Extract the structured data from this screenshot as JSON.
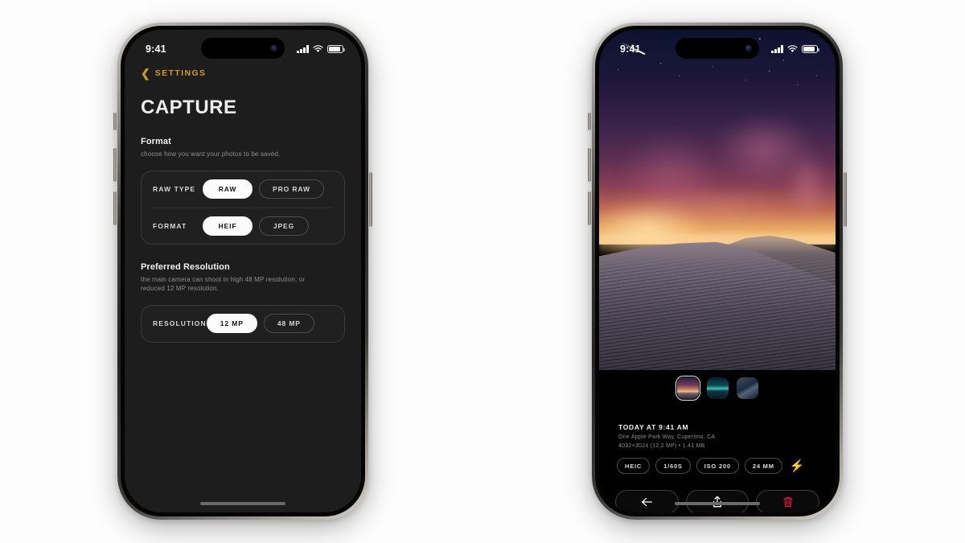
{
  "left_phone": {
    "status_bar": {
      "time": "9:41",
      "cellular_icon": "signal-bars-icon",
      "wifi_icon": "wifi-icon",
      "battery_icon": "battery-icon"
    },
    "nav": {
      "back_icon": "chevron-left-icon",
      "back_label": "SETTINGS",
      "accent_color": "#cf9a1e"
    },
    "page_title": "CAPTURE",
    "sections": [
      {
        "title": "Format",
        "description": "choose how you want your photos to be saved.",
        "rows": [
          {
            "label": "RAW TYPE",
            "options": [
              {
                "label": "RAW",
                "selected": true
              },
              {
                "label": "PRO RAW",
                "selected": false
              }
            ]
          },
          {
            "label": "FORMAT",
            "options": [
              {
                "label": "HEIF",
                "selected": true
              },
              {
                "label": "JPEG",
                "selected": false
              }
            ]
          }
        ]
      },
      {
        "title": "Preferred Resolution",
        "description": "the main camera can shoot in high 48 MP resolution, or reduced 12 MP resolution.",
        "rows": [
          {
            "label": "RESOLUTION",
            "options": [
              {
                "label": "12 MP",
                "selected": true
              },
              {
                "label": "48 MP",
                "selected": false
              }
            ]
          }
        ]
      }
    ]
  },
  "right_phone": {
    "status_bar": {
      "time": "9:41",
      "cellular_icon": "signal-bars-icon",
      "wifi_icon": "wifi-icon",
      "battery_icon": "battery-icon"
    },
    "photo": {
      "description": "desert sand dune at twilight with starry sky and shooting star"
    },
    "thumbnails": [
      {
        "name": "thumbnail-dune-sunset",
        "selected": true
      },
      {
        "name": "thumbnail-aurora",
        "selected": false
      },
      {
        "name": "thumbnail-blue-landscape",
        "selected": false
      }
    ],
    "metadata": {
      "title": "TODAY AT 9:41 AM",
      "location": "One Apple Park Way, Cupertino, CA",
      "details": "4032×3024 (12.2 MP) • 1.41 MB"
    },
    "chips": [
      {
        "label": "HEIC"
      },
      {
        "label": "1/60S"
      },
      {
        "label": "ISO 200"
      },
      {
        "label": "24 MM"
      }
    ],
    "flash_icon": "lightning-bolt-icon",
    "actions": [
      {
        "name": "back-button",
        "icon": "arrow-left-icon",
        "color": "#ffffff"
      },
      {
        "name": "share-button",
        "icon": "share-upload-icon",
        "color": "#ffffff"
      },
      {
        "name": "delete-button",
        "icon": "trash-icon",
        "color": "#d6173a"
      }
    ]
  }
}
